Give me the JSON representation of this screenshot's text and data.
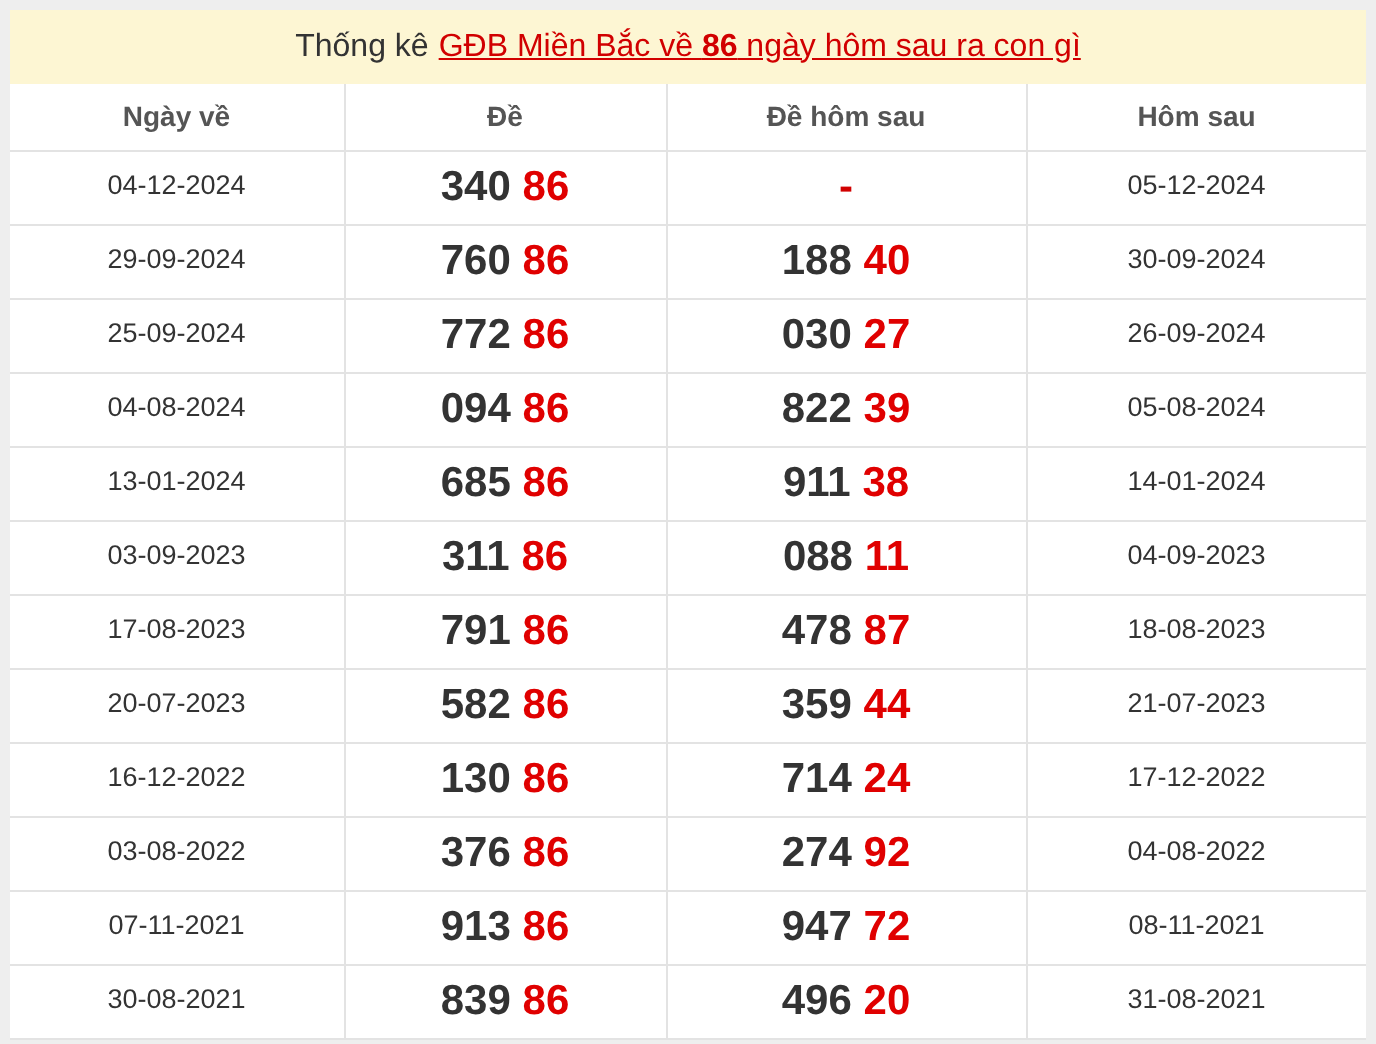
{
  "title": {
    "lead": "Thống kê",
    "link": "GĐB Miền Bắc về **86** ngày hôm sau ra con gì"
  },
  "table": {
    "columns": [
      "Ngày về",
      "Đề",
      "Đề hôm sau",
      "Hôm sau"
    ],
    "rows": [
      {
        "date": "04-12-2024",
        "de": {
          "kind": "pair",
          "head": "340",
          "tail": "86"
        },
        "next_de": {
          "kind": "dash",
          "text": "-"
        },
        "next_date": "05-12-2024"
      },
      {
        "date": "29-09-2024",
        "de": {
          "kind": "pair",
          "head": "760",
          "tail": "86"
        },
        "next_de": {
          "kind": "pair",
          "head": "188",
          "tail": "40"
        },
        "next_date": "30-09-2024"
      },
      {
        "date": "25-09-2024",
        "de": {
          "kind": "pair",
          "head": "772",
          "tail": "86"
        },
        "next_de": {
          "kind": "pair",
          "head": "030",
          "tail": "27"
        },
        "next_date": "26-09-2024"
      },
      {
        "date": "04-08-2024",
        "de": {
          "kind": "pair",
          "head": "094",
          "tail": "86"
        },
        "next_de": {
          "kind": "pair",
          "head": "822",
          "tail": "39"
        },
        "next_date": "05-08-2024"
      },
      {
        "date": "13-01-2024",
        "de": {
          "kind": "pair",
          "head": "685",
          "tail": "86"
        },
        "next_de": {
          "kind": "pair",
          "head": "911",
          "tail": "38"
        },
        "next_date": "14-01-2024"
      },
      {
        "date": "03-09-2023",
        "de": {
          "kind": "pair",
          "head": "311",
          "tail": "86"
        },
        "next_de": {
          "kind": "pair",
          "head": "088",
          "tail": "11"
        },
        "next_date": "04-09-2023"
      },
      {
        "date": "17-08-2023",
        "de": {
          "kind": "pair",
          "head": "791",
          "tail": "86"
        },
        "next_de": {
          "kind": "pair",
          "head": "478",
          "tail": "87"
        },
        "next_date": "18-08-2023"
      },
      {
        "date": "20-07-2023",
        "de": {
          "kind": "pair",
          "head": "582",
          "tail": "86"
        },
        "next_de": {
          "kind": "pair",
          "head": "359",
          "tail": "44"
        },
        "next_date": "21-07-2023"
      },
      {
        "date": "16-12-2022",
        "de": {
          "kind": "pair",
          "head": "130",
          "tail": "86"
        },
        "next_de": {
          "kind": "pair",
          "head": "714",
          "tail": "24"
        },
        "next_date": "17-12-2022"
      },
      {
        "date": "03-08-2022",
        "de": {
          "kind": "pair",
          "head": "376",
          "tail": "86"
        },
        "next_de": {
          "kind": "pair",
          "head": "274",
          "tail": "92"
        },
        "next_date": "04-08-2022"
      },
      {
        "date": "07-11-2021",
        "de": {
          "kind": "pair",
          "head": "913",
          "tail": "86"
        },
        "next_de": {
          "kind": "pair",
          "head": "947",
          "tail": "72"
        },
        "next_date": "08-11-2021"
      },
      {
        "date": "30-08-2021",
        "de": {
          "kind": "pair",
          "head": "839",
          "tail": "86"
        },
        "next_de": {
          "kind": "pair",
          "head": "496",
          "tail": "20"
        },
        "next_date": "31-08-2021"
      }
    ]
  }
}
